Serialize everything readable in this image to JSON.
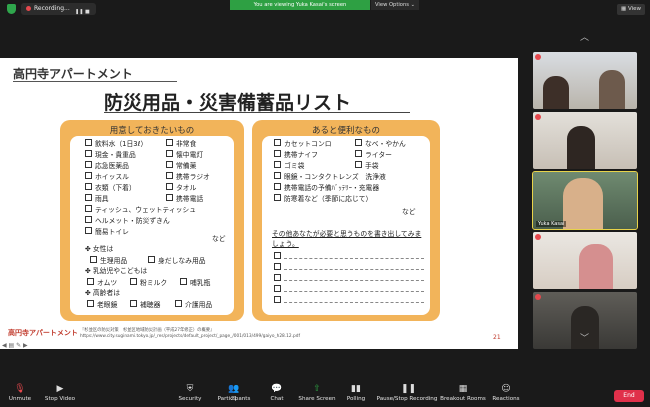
{
  "topbar": {
    "recording_label": "Recording...",
    "share_banner": "You are viewing Yuka Kasai's screen",
    "view_options": "View Options",
    "view_button": "View"
  },
  "slide": {
    "deck_title": "高円寺アパートメント",
    "main_title": "防災用品・災害備蓄品リスト",
    "left_box": {
      "heading": "用意しておきたいもの",
      "col1": [
        "飲料水（1日3ℓ）",
        "現金・貴重品",
        "応急医薬品",
        "ホイッスル",
        "衣類（下着）",
        "雨具",
        "ティッシュ、ウェットティッシュ",
        "ヘルメット・防災ずきん",
        "簡易トイレ"
      ],
      "col2": [
        "非常食",
        "懐中電灯",
        "常備薬",
        "携帯ラジオ",
        "タオル",
        "携帯電話"
      ],
      "nado": "など",
      "women_head": "女性は",
      "women_items": [
        "生理用品",
        "身だしなみ用品"
      ],
      "kids_head": "乳幼児やこどもは",
      "kids_items": [
        "オムツ",
        "粉ミルク",
        "哺乳瓶"
      ],
      "elder_head": "高齢者は",
      "elder_items": [
        "老眼鏡",
        "補聴器",
        "介護用品"
      ]
    },
    "right_box": {
      "heading": "あると便利なもの",
      "col1": [
        "カセットコンロ",
        "携帯ナイフ",
        "ゴミ袋",
        "眼鏡・コンタクトレンズ　洗浄液",
        "携帯電話の予備ﾊﾞｯﾃﾘｰ・充電器",
        "防寒着など（季節に応じて）"
      ],
      "col2": [
        "なべ・やかん",
        "ライター",
        "手袋"
      ],
      "nado": "など",
      "prompt": "その他あなたが必要と思うものを書き出してみましょう。"
    },
    "source_line1": "『杉並区の防災対策　杉並区地域防災計画（平成27年修正）の概要』",
    "source_line2": "https://www.city.suginami.tokyo.jp/_res/projects/default_project/_page_/001/013/499/gaiyo_h28.12.pdf",
    "logo_text": "高円寺アパートメント",
    "page_number": "21"
  },
  "gallery": {
    "active_name": "Yuka Kasai"
  },
  "toolbar": {
    "unmute": "Unmute",
    "stop_video": "Stop Video",
    "security": "Security",
    "participants": "Participants",
    "participants_count": "21",
    "chat": "Chat",
    "share_screen": "Share Screen",
    "polling": "Polling",
    "pause_recording": "Pause/Stop Recording",
    "breakout": "Breakout Rooms",
    "reactions": "Reactions",
    "end": "End"
  }
}
